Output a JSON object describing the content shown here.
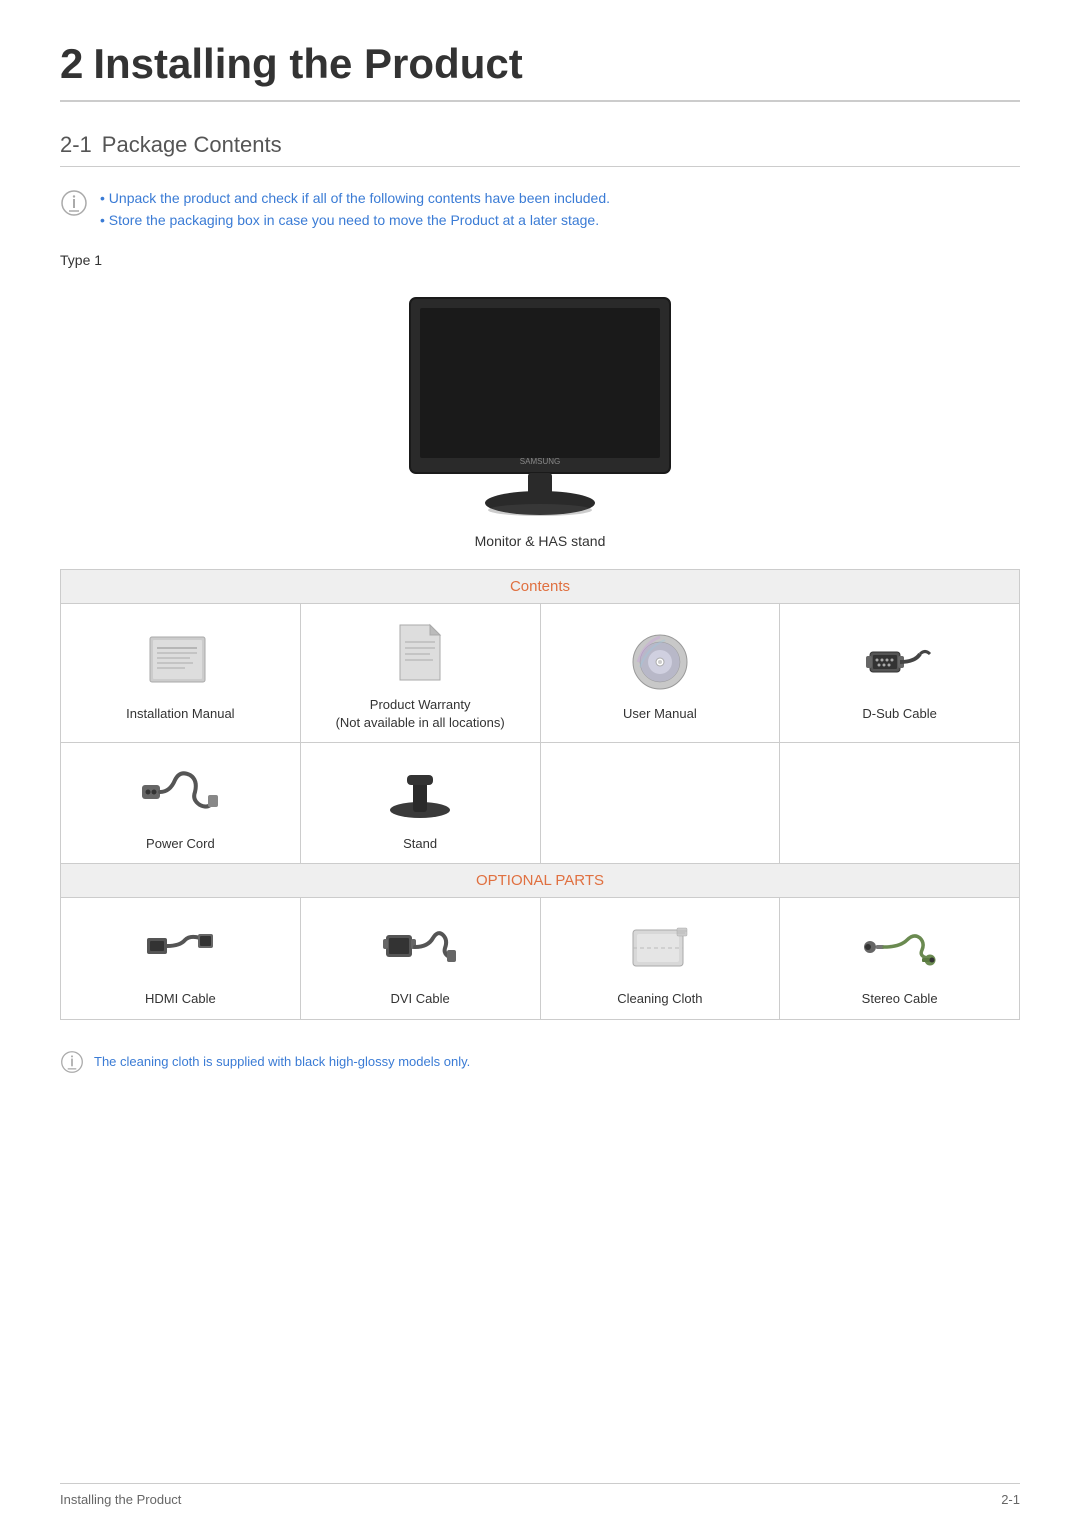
{
  "page": {
    "chapter_number": "2",
    "chapter_title": "Installing the Product",
    "section_number": "2-1",
    "section_title": "Package Contents"
  },
  "notes": {
    "note1": "Unpack the product and check if all of the following contents have been included.",
    "note2": "Store the packaging box in case you need to move the Product at a later stage."
  },
  "type_label": "Type 1",
  "monitor_caption": "Monitor & HAS stand",
  "contents_header": "Contents",
  "optional_header": "OPTIONAL PARTS",
  "items": {
    "installation_manual": "Installation Manual",
    "product_warranty": "Product Warranty",
    "product_warranty_sub": "(Not available in all locations)",
    "user_manual": "User Manual",
    "dsub_cable": "D-Sub Cable",
    "power_cord": "Power Cord",
    "stand": "Stand",
    "hdmi_cable": "HDMI Cable",
    "dvi_cable": "DVI Cable",
    "cleaning_cloth": "Cleaning Cloth",
    "stereo_cable": "Stereo Cable"
  },
  "footer_note": "The cleaning cloth is supplied with black high-glossy models only.",
  "footer_left": "Installing the Product",
  "footer_right": "2-1"
}
